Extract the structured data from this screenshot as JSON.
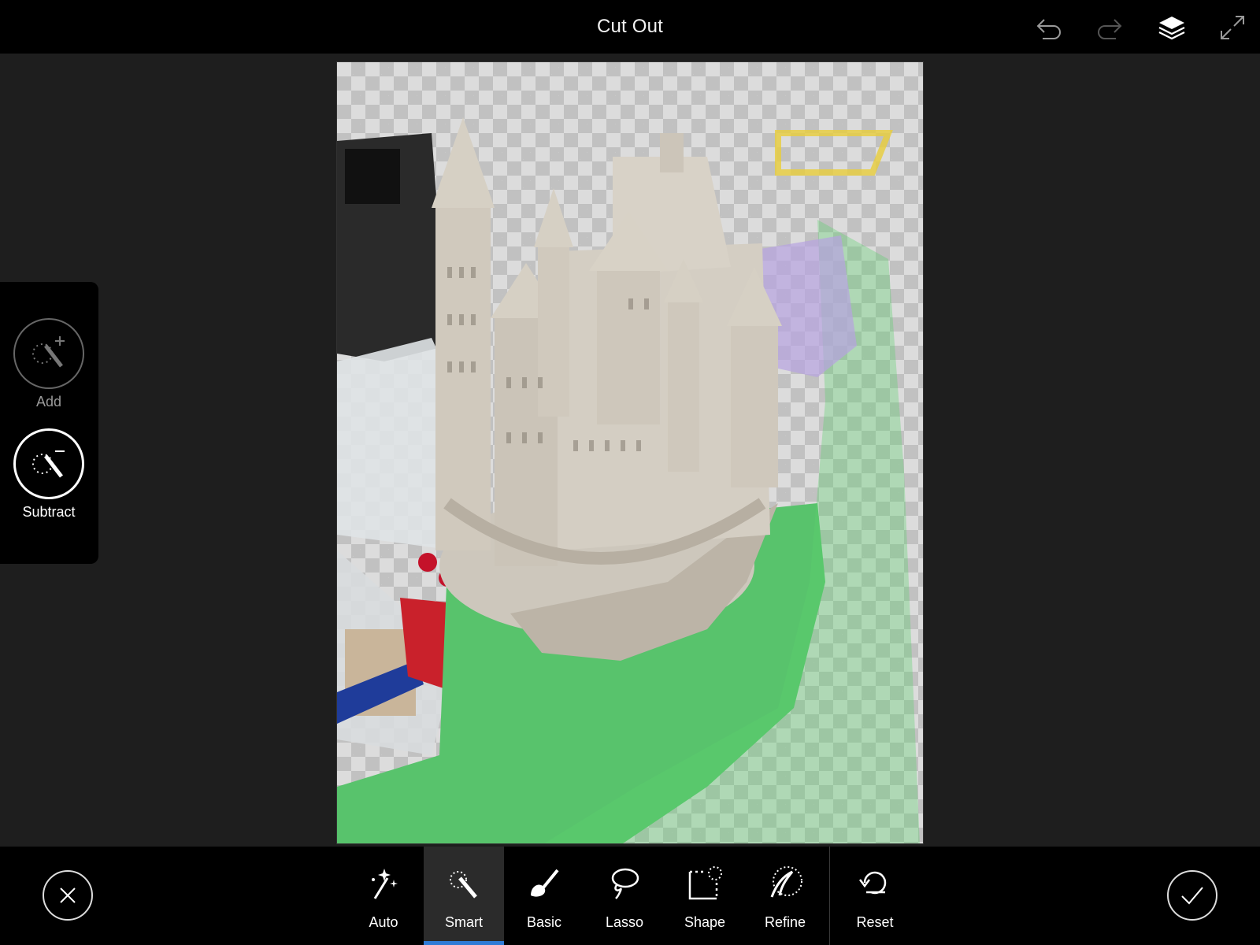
{
  "header": {
    "title": "Cut Out",
    "icons": [
      "undo-icon",
      "redo-icon",
      "layers-icon",
      "expand-icon"
    ]
  },
  "selection_modes": [
    {
      "label": "Add",
      "icon": "magic-wand-add-icon",
      "active": false
    },
    {
      "label": "Subtract",
      "icon": "magic-wand-subtract-icon",
      "active": true
    }
  ],
  "toolbar": {
    "cancel_icon": "close-icon",
    "confirm_icon": "checkmark-icon",
    "tools": [
      {
        "label": "Auto",
        "icon": "sparkle-wand-icon",
        "active": false
      },
      {
        "label": "Smart",
        "icon": "smart-wand-icon",
        "active": true
      },
      {
        "label": "Basic",
        "icon": "brush-icon",
        "active": false
      },
      {
        "label": "Lasso",
        "icon": "lasso-icon",
        "active": false
      },
      {
        "label": "Shape",
        "icon": "shape-select-icon",
        "active": false
      },
      {
        "label": "Refine",
        "icon": "refine-icon",
        "active": false
      }
    ],
    "reset_label": "Reset"
  },
  "colors": {
    "accent": "#2f7bd6",
    "selection_overlay": "#5bd06c",
    "background": "#1e1e1e",
    "bar": "#000000"
  }
}
